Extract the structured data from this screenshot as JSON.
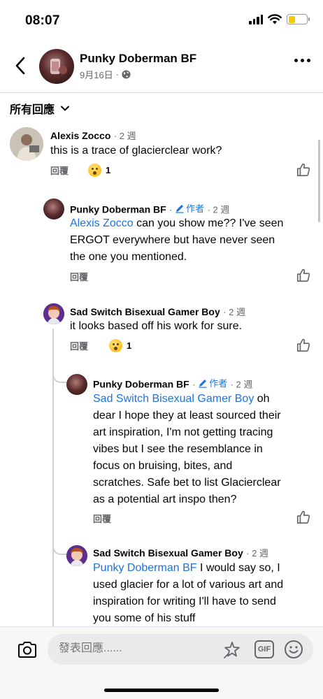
{
  "status_bar": {
    "time": "08:07"
  },
  "header": {
    "name": "Punky Doberman BF",
    "date": "9月16日",
    "separator": "·"
  },
  "sort": {
    "label": "所有回應"
  },
  "comments": [
    {
      "name": "Alexis Zocco",
      "time": "2 週",
      "text": "this is a trace of glacierclear work?",
      "reply_label": "回覆",
      "reaction_count": "1"
    },
    {
      "name": "Punky Doberman BF",
      "author_label": "作者",
      "time": "2 週",
      "mention": "Alexis Zocco",
      "text_line1_rest": " can you show me?? I've seen",
      "text_line2": "ERGOT everywhere but have never seen",
      "text_line3": "the one you mentioned.",
      "reply_label": "回覆"
    },
    {
      "name": "Sad Switch Bisexual Gamer Boy",
      "time": "2 週",
      "text": "it looks based off his work for sure.",
      "reply_label": "回覆",
      "reaction_count": "1"
    },
    {
      "name": "Punky Doberman BF",
      "author_label": "作者",
      "time": "2 週",
      "mention": "Sad Switch Bisexual Gamer Boy",
      "text_line1_rest": " oh",
      "text_line2": "dear I hope they at least sourced their",
      "text_line3": "art inspiration, I'm not getting tracing",
      "text_line4": "vibes but I see the resemblance in",
      "text_line5": "focus on bruising, bites, and",
      "text_line6": "scratches. Safe bet to list Glacierclear",
      "text_line7": "as a potential art inspo then?",
      "reply_label": "回覆"
    },
    {
      "name": "Sad Switch Bisexual Gamer Boy",
      "time": "2 週",
      "mention": "Punky Doberman BF",
      "text_line1_rest": " I would say so, I",
      "text_line2": "used glacier for a lot of various art and",
      "text_line3": "inspiration for writing I'll have to send",
      "text_line4": "you some of his stuff"
    }
  ],
  "composer": {
    "placeholder": "發表回應......"
  },
  "colors": {
    "link": "#1b74e4",
    "muted": "#65676b",
    "thread_line": "#ced0d4"
  }
}
